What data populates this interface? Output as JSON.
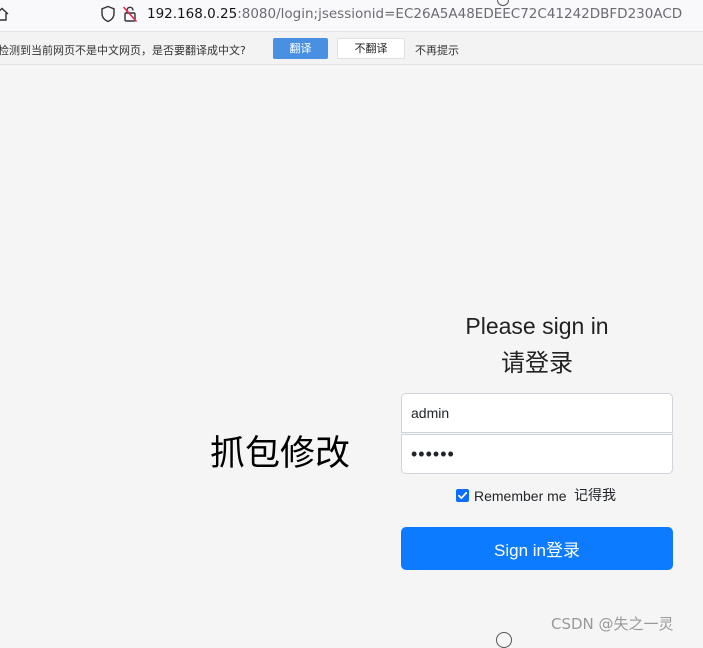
{
  "browser": {
    "url_host": "192.168.0.25",
    "url_rest": ":8080/login;jsessionid=EC26A5A48EDEEC72C41242DBFD230ACD",
    "icons": [
      "home-icon",
      "shield-icon",
      "lock-icon"
    ]
  },
  "translate_bar": {
    "message": "检测到当前网页不是中文网页，是否要翻译成中文?",
    "translate_label": "翻译",
    "no_translate_label": "不翻译",
    "no_prompt_label": "不再提示",
    "accent_color": "#4a90e2"
  },
  "login": {
    "heading": "Please sign in",
    "heading_cn": "请登录",
    "username_value": "admin",
    "password_value": "••••••",
    "remember_label": "Remember me",
    "remember_label_cn": "记得我",
    "remember_checked": true,
    "signin_label": "Sign in登录",
    "button_color": "#0d7bff"
  },
  "annotation": "抓包修改",
  "watermark": "CSDN @失之一灵"
}
